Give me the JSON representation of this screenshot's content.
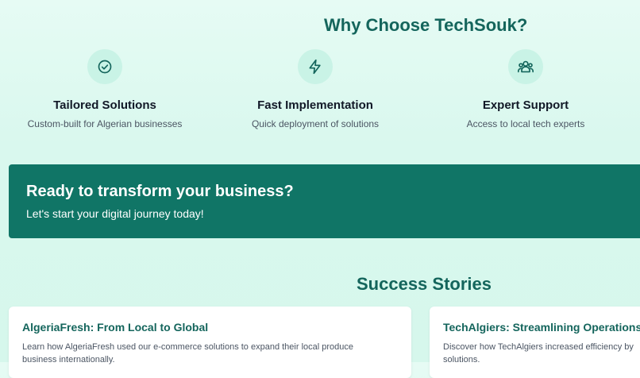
{
  "why_section": {
    "title": "Why Choose TechSouk?",
    "features": [
      {
        "icon": "check-circle-icon",
        "title": "Tailored Solutions",
        "description": "Custom-built for Algerian businesses"
      },
      {
        "icon": "lightning-icon",
        "title": "Fast Implementation",
        "description": "Quick deployment of solutions"
      },
      {
        "icon": "users-group-icon",
        "title": "Expert Support",
        "description": "Access to local tech experts"
      }
    ]
  },
  "cta": {
    "title": "Ready to transform your business?",
    "subtitle": "Let's start your digital journey today!"
  },
  "stories_section": {
    "title": "Success Stories",
    "stories": [
      {
        "title": "AlgeriaFresh: From Local to Global",
        "description": "Learn how AlgeriaFresh used our e-commerce solutions to expand their local produce business internationally."
      },
      {
        "title": "TechAlgiers: Streamlining Operations",
        "description": "Discover how TechAlgiers increased efficiency by solutions."
      }
    ]
  },
  "colors": {
    "accent": "#14655c",
    "cta_background": "#107566",
    "icon_background": "#c9f3e6",
    "page_background": "#dff9f0"
  }
}
